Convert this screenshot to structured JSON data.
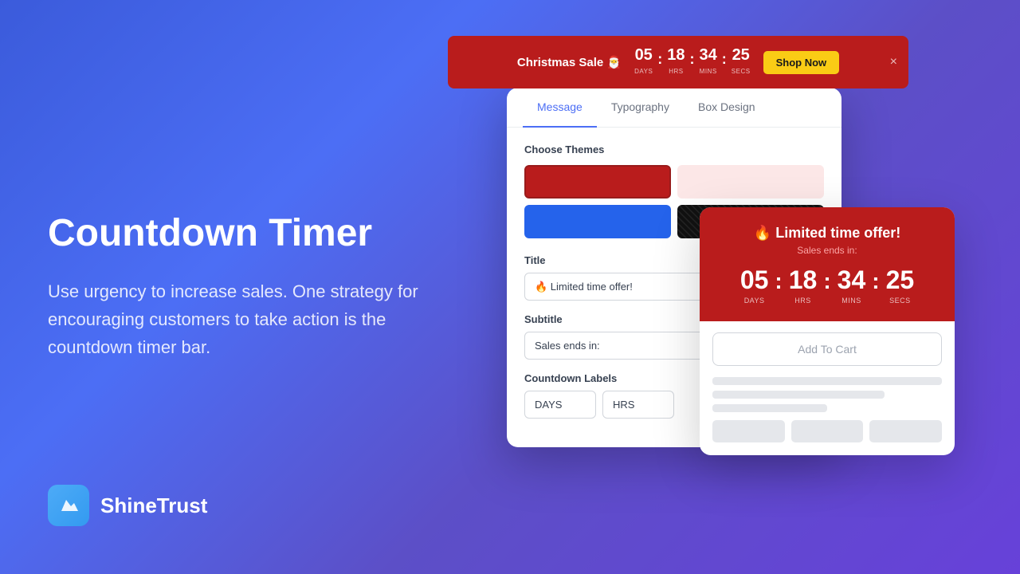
{
  "brand": {
    "logo": "S",
    "name": "ShineTrust"
  },
  "left": {
    "title": "Countdown Timer",
    "description": "Use urgency to increase sales. One strategy for encouraging customers to take action is the countdown timer bar."
  },
  "banner": {
    "title": "Christmas Sale 🎅",
    "days": "05",
    "hrs": "18",
    "mins": "34",
    "secs": "25",
    "days_label": "DAYS",
    "hrs_label": "HRS",
    "mins_label": "MINS",
    "secs_label": "SECS",
    "shop_now": "Shop Now",
    "close": "×"
  },
  "panel": {
    "tabs": [
      {
        "label": "Message",
        "active": true
      },
      {
        "label": "Typography",
        "active": false
      },
      {
        "label": "Box Design",
        "active": false
      }
    ],
    "themes_label": "Choose Themes",
    "title_label": "Title",
    "title_value": "🔥 Limited time offer!",
    "subtitle_label": "Subtitle",
    "subtitle_value": "Sales ends in:",
    "countdown_labels_label": "Countdown Labels",
    "label_days": "DAYS",
    "label_hrs": "HRS"
  },
  "preview": {
    "title": "🔥 Limited time offer!",
    "subtitle": "Sales ends in:",
    "days": "05",
    "hrs": "18",
    "mins": "34",
    "secs": "25",
    "days_label": "DAYS",
    "hrs_label": "HRS",
    "mins_label": "MINS",
    "secs_label": "SECS",
    "add_to_cart": "Add To Cart"
  }
}
